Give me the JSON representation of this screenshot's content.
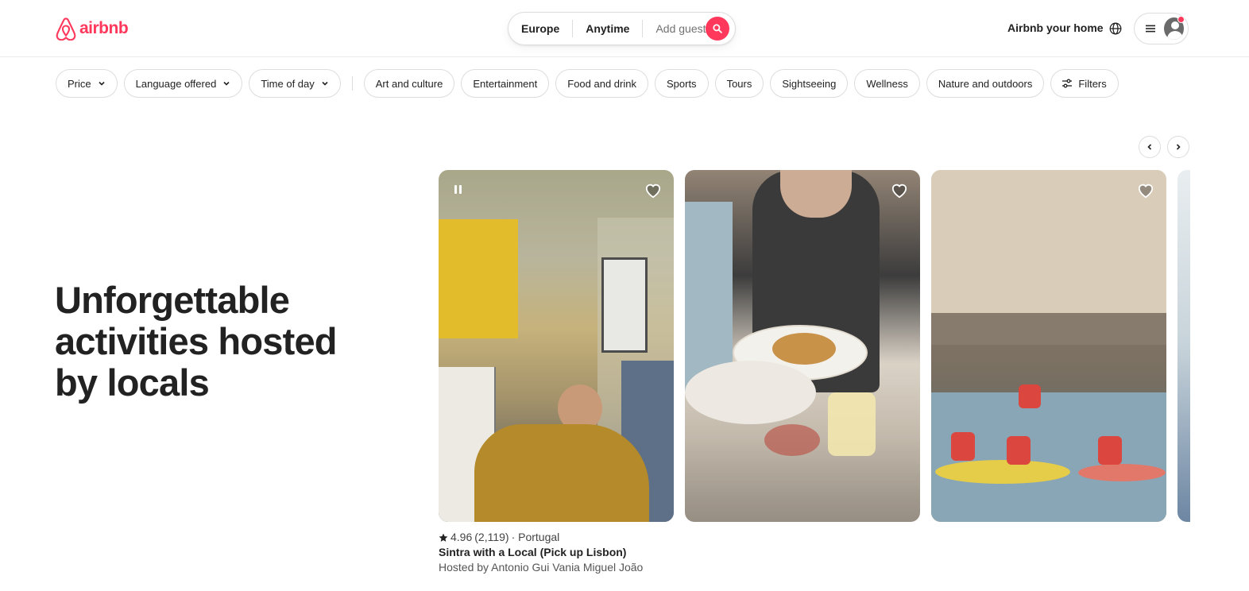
{
  "header": {
    "logo_text": "airbnb",
    "search": {
      "destination": "Europe",
      "dates": "Anytime",
      "guests_placeholder": "Add guests"
    },
    "host_link": "Airbnb your home"
  },
  "filters": {
    "dropdowns": [
      "Price",
      "Language offered",
      "Time of day"
    ],
    "categories": [
      "Art and culture",
      "Entertainment",
      "Food and drink",
      "Sports",
      "Tours",
      "Sightseeing",
      "Wellness",
      "Nature and outdoors"
    ],
    "filters_label": "Filters"
  },
  "hero": {
    "title_line1": "Unforgettable",
    "title_line2": "activities hosted",
    "title_line3": "by locals"
  },
  "featured": {
    "rating": "4.96",
    "reviews": "(2,119)",
    "location": "· Portugal",
    "title": "Sintra with a Local (Pick up Lisbon)",
    "host": "Hosted by Antonio Gui Vania Miguel João"
  },
  "colors": {
    "brand": "#ff385c",
    "text": "#222222",
    "border": "#dddddd"
  }
}
